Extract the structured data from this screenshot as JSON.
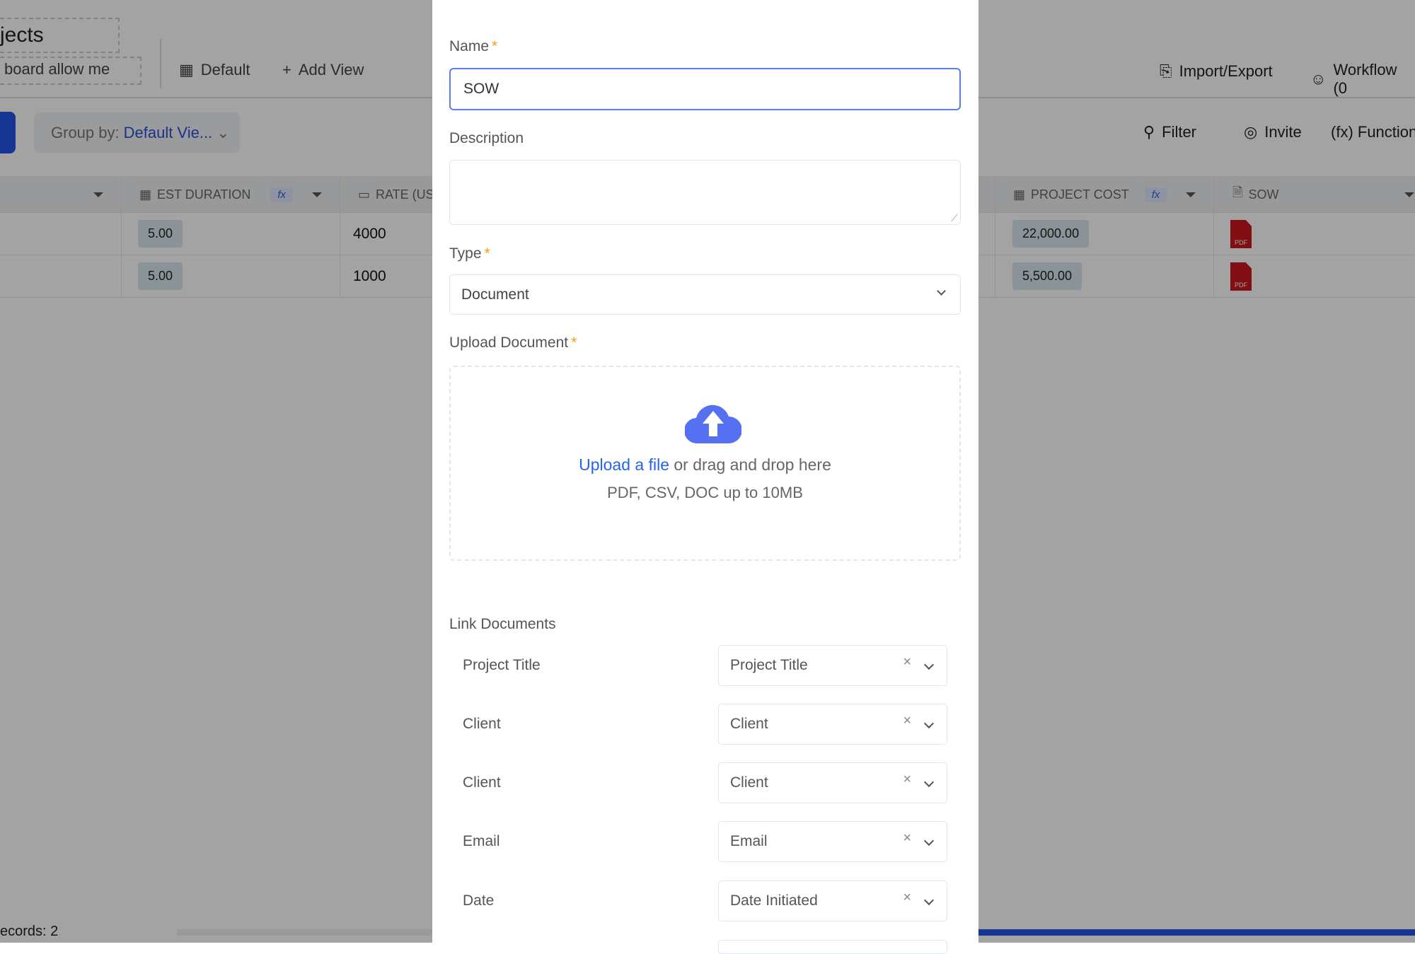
{
  "board": {
    "title": "jects",
    "description": "board allow me",
    "views": [
      {
        "label": "Default",
        "icon": "grid-icon"
      },
      {
        "label": "Add View",
        "icon": "plus-icon"
      }
    ],
    "import_export": "Import/Export",
    "workflow": "Workflow (0",
    "group_by_label": "Group by:",
    "group_by_value": "Default Vie...",
    "filter": "Filter",
    "invite": "Invite",
    "function": "(fx) Function",
    "columns": [
      {
        "label": "EST DURATION",
        "fx": "fx"
      },
      {
        "label": "RATE (USD"
      },
      {
        "label": "PROJECT COST",
        "fx": "fx"
      },
      {
        "label": "SOW"
      }
    ],
    "rows": [
      {
        "duration": "5.00",
        "rate": "4000",
        "cost": "22,000.00",
        "sow": "PDF"
      },
      {
        "duration": "5.00",
        "rate": "1000",
        "cost": "5,500.00",
        "sow": "PDF"
      }
    ],
    "records": "ecords: 2"
  },
  "modal": {
    "name_label": "Name",
    "name_value": "SOW",
    "required": "*",
    "description_label": "Description",
    "description_value": "",
    "type_label": "Type",
    "type_value": "Document",
    "upload_label": "Upload Document",
    "upload_link": "Upload a file",
    "upload_text": " or drag and drop here",
    "upload_hint": "PDF, CSV, DOC up to 10MB",
    "link_label": "Link Documents",
    "links": [
      {
        "label": "Project Title",
        "value": "Project Title"
      },
      {
        "label": "Client",
        "value": "Client"
      },
      {
        "label": "Client",
        "value": "Client"
      },
      {
        "label": "Email",
        "value": "Email"
      },
      {
        "label": "Date",
        "value": "Date Initiated"
      }
    ],
    "clear": "×"
  },
  "colors": {
    "accent": "#5570f1",
    "link": "#2563eb",
    "pdf": "#c8161d",
    "required": "#f59e0b"
  }
}
